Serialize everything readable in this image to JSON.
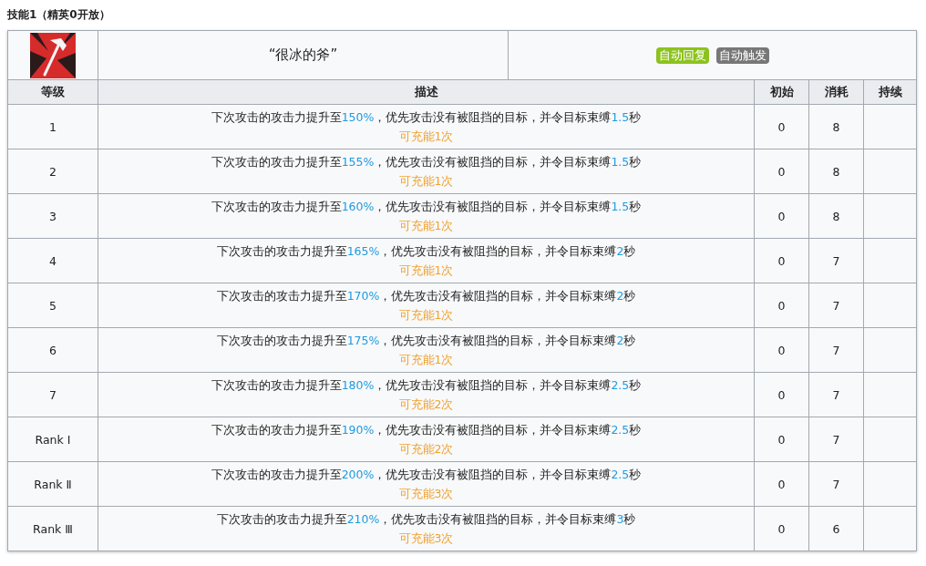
{
  "heading": "技能1（精英0开放）",
  "skill": {
    "name": "“很冰的斧”",
    "tags": [
      {
        "label": "自动回复",
        "color": "#8cc21f"
      },
      {
        "label": "自动触发",
        "color": "#777777"
      }
    ]
  },
  "columns": [
    "等级",
    "描述",
    "初始",
    "消耗",
    "持续"
  ],
  "rows": [
    {
      "level": "1",
      "description": [
        {
          "kind": "plain",
          "text": "下次攻击的攻击力提升至"
        },
        {
          "kind": "value",
          "text": "150%"
        },
        {
          "kind": "plain",
          "text": "，优先攻击没有被阻挡的目标，并令目标束缚"
        },
        {
          "kind": "value",
          "text": "1.5"
        },
        {
          "kind": "plain",
          "text": "秒"
        }
      ],
      "charges": "可充能1次",
      "initial": "0",
      "cost": "8"
    },
    {
      "level": "2",
      "description": [
        {
          "kind": "plain",
          "text": "下次攻击的攻击力提升至"
        },
        {
          "kind": "value",
          "text": "155%"
        },
        {
          "kind": "plain",
          "text": "，优先攻击没有被阻挡的目标，并令目标束缚"
        },
        {
          "kind": "value",
          "text": "1.5"
        },
        {
          "kind": "plain",
          "text": "秒"
        }
      ],
      "charges": "可充能1次",
      "initial": "0",
      "cost": "8"
    },
    {
      "level": "3",
      "description": [
        {
          "kind": "plain",
          "text": "下次攻击的攻击力提升至"
        },
        {
          "kind": "value",
          "text": "160%"
        },
        {
          "kind": "plain",
          "text": "，优先攻击没有被阻挡的目标，并令目标束缚"
        },
        {
          "kind": "value",
          "text": "1.5"
        },
        {
          "kind": "plain",
          "text": "秒"
        }
      ],
      "charges": "可充能1次",
      "initial": "0",
      "cost": "8"
    },
    {
      "level": "4",
      "description": [
        {
          "kind": "plain",
          "text": "下次攻击的攻击力提升至"
        },
        {
          "kind": "value",
          "text": "165%"
        },
        {
          "kind": "plain",
          "text": "，优先攻击没有被阻挡的目标，并令目标束缚"
        },
        {
          "kind": "value",
          "text": "2"
        },
        {
          "kind": "plain",
          "text": "秒"
        }
      ],
      "charges": "可充能1次",
      "initial": "0",
      "cost": "7"
    },
    {
      "level": "5",
      "description": [
        {
          "kind": "plain",
          "text": "下次攻击的攻击力提升至"
        },
        {
          "kind": "value",
          "text": "170%"
        },
        {
          "kind": "plain",
          "text": "，优先攻击没有被阻挡的目标，并令目标束缚"
        },
        {
          "kind": "value",
          "text": "2"
        },
        {
          "kind": "plain",
          "text": "秒"
        }
      ],
      "charges": "可充能1次",
      "initial": "0",
      "cost": "7"
    },
    {
      "level": "6",
      "description": [
        {
          "kind": "plain",
          "text": "下次攻击的攻击力提升至"
        },
        {
          "kind": "value",
          "text": "175%"
        },
        {
          "kind": "plain",
          "text": "，优先攻击没有被阻挡的目标，并令目标束缚"
        },
        {
          "kind": "value",
          "text": "2"
        },
        {
          "kind": "plain",
          "text": "秒"
        }
      ],
      "charges": "可充能1次",
      "initial": "0",
      "cost": "7"
    },
    {
      "level": "7",
      "description": [
        {
          "kind": "plain",
          "text": "下次攻击的攻击力提升至"
        },
        {
          "kind": "value",
          "text": "180%"
        },
        {
          "kind": "plain",
          "text": "，优先攻击没有被阻挡的目标，并令目标束缚"
        },
        {
          "kind": "value",
          "text": "2.5"
        },
        {
          "kind": "plain",
          "text": "秒"
        }
      ],
      "charges": "可充能2次",
      "initial": "0",
      "cost": "7"
    },
    {
      "level": "Rank Ⅰ",
      "description": [
        {
          "kind": "plain",
          "text": "下次攻击的攻击力提升至"
        },
        {
          "kind": "value",
          "text": "190%"
        },
        {
          "kind": "plain",
          "text": "，优先攻击没有被阻挡的目标，并令目标束缚"
        },
        {
          "kind": "value",
          "text": "2.5"
        },
        {
          "kind": "plain",
          "text": "秒"
        }
      ],
      "charges": "可充能2次",
      "initial": "0",
      "cost": "7"
    },
    {
      "level": "Rank Ⅱ",
      "description": [
        {
          "kind": "plain",
          "text": "下次攻击的攻击力提升至"
        },
        {
          "kind": "value",
          "text": "200%"
        },
        {
          "kind": "plain",
          "text": "，优先攻击没有被阻挡的目标，并令目标束缚"
        },
        {
          "kind": "value",
          "text": "2.5"
        },
        {
          "kind": "plain",
          "text": "秒"
        }
      ],
      "charges": "可充能3次",
      "initial": "0",
      "cost": "7"
    },
    {
      "level": "Rank Ⅲ",
      "description": [
        {
          "kind": "plain",
          "text": "下次攻击的攻击力提升至"
        },
        {
          "kind": "value",
          "text": "210%"
        },
        {
          "kind": "plain",
          "text": "，优先攻击没有被阻挡的目标，并令目标束缚"
        },
        {
          "kind": "value",
          "text": "3"
        },
        {
          "kind": "plain",
          "text": "秒"
        }
      ],
      "charges": "可充能3次",
      "initial": "0",
      "cost": "6"
    }
  ]
}
